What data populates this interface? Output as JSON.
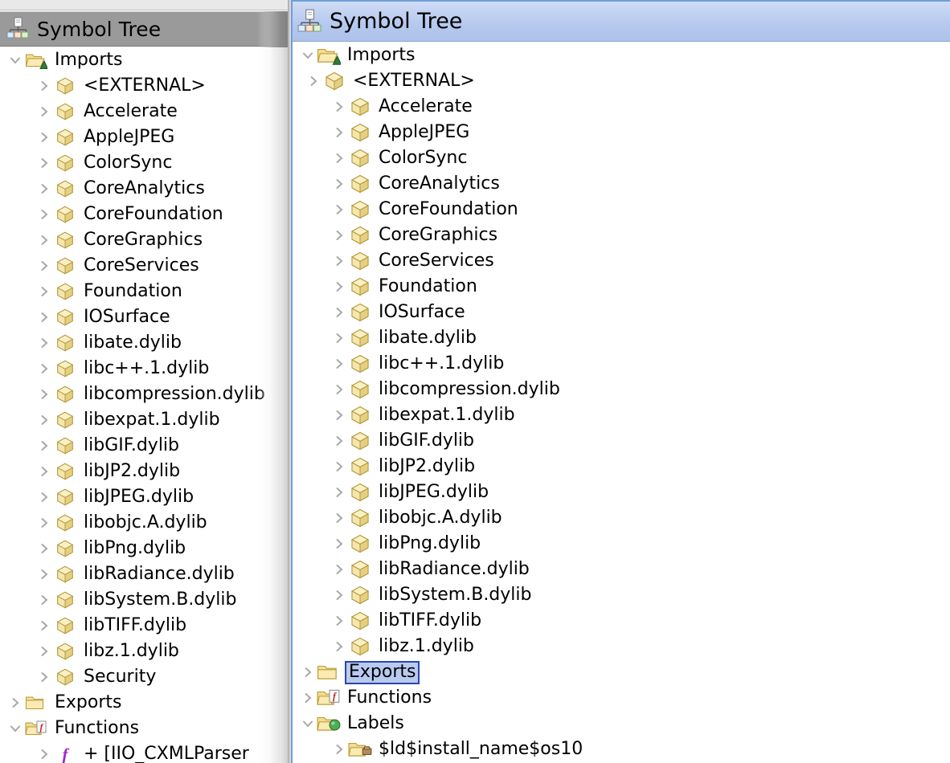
{
  "window": {
    "background_panel": {
      "title": "Symbol Tree",
      "icon": "symbol-tree-icon",
      "focused": false,
      "header_color": "#9a9a9a"
    },
    "foreground_panel": {
      "title": "Symbol Tree",
      "icon": "symbol-tree-icon",
      "focused": true,
      "header_color": "#b6c9ee",
      "border_color": "#6f9fd8"
    }
  },
  "selection": {
    "label": "Exports",
    "fill_color": "#b9caf1",
    "border_color": "#2a46a8"
  },
  "tree": {
    "root_items": [
      {
        "label": "Imports",
        "icon": "folder-open-imports-icon",
        "expanded": true,
        "level": 1
      },
      {
        "label": "Exports",
        "icon": "folder-closed-icon",
        "expanded": false,
        "level": 1
      },
      {
        "label": "Functions",
        "icon": "folder-functions-icon",
        "expanded": false,
        "level": 1
      },
      {
        "label": "Labels",
        "icon": "folder-labels-icon",
        "expanded": true,
        "level": 1
      }
    ],
    "imports_children": [
      {
        "label": "<EXTERNAL>",
        "icon": "library-cube-icon",
        "expanded": false,
        "extra_indent": true
      },
      {
        "label": "Accelerate",
        "icon": "library-cube-icon",
        "expanded": false
      },
      {
        "label": "AppleJPEG",
        "icon": "library-cube-icon",
        "expanded": false
      },
      {
        "label": "ColorSync",
        "icon": "library-cube-icon",
        "expanded": false
      },
      {
        "label": "CoreAnalytics",
        "icon": "library-cube-icon",
        "expanded": false
      },
      {
        "label": "CoreFoundation",
        "icon": "library-cube-icon",
        "expanded": false
      },
      {
        "label": "CoreGraphics",
        "icon": "library-cube-icon",
        "expanded": false
      },
      {
        "label": "CoreServices",
        "icon": "library-cube-icon",
        "expanded": false
      },
      {
        "label": "Foundation",
        "icon": "library-cube-icon",
        "expanded": false
      },
      {
        "label": "IOSurface",
        "icon": "library-cube-icon",
        "expanded": false
      },
      {
        "label": "libate.dylib",
        "icon": "library-cube-icon",
        "expanded": false
      },
      {
        "label": "libc++.1.dylib",
        "icon": "library-cube-icon",
        "expanded": false
      },
      {
        "label": "libcompression.dylib",
        "icon": "library-cube-icon",
        "expanded": false
      },
      {
        "label": "libexpat.1.dylib",
        "icon": "library-cube-icon",
        "expanded": false
      },
      {
        "label": "libGIF.dylib",
        "icon": "library-cube-icon",
        "expanded": false
      },
      {
        "label": "libJP2.dylib",
        "icon": "library-cube-icon",
        "expanded": false
      },
      {
        "label": "libJPEG.dylib",
        "icon": "library-cube-icon",
        "expanded": false
      },
      {
        "label": "libobjc.A.dylib",
        "icon": "library-cube-icon",
        "expanded": false
      },
      {
        "label": "libPng.dylib",
        "icon": "library-cube-icon",
        "expanded": false
      },
      {
        "label": "libRadiance.dylib",
        "icon": "library-cube-icon",
        "expanded": false
      },
      {
        "label": "libSystem.B.dylib",
        "icon": "library-cube-icon",
        "expanded": false
      },
      {
        "label": "libTIFF.dylib",
        "icon": "library-cube-icon",
        "expanded": false
      },
      {
        "label": "libz.1.dylib",
        "icon": "library-cube-icon",
        "expanded": false
      },
      {
        "label": "Security",
        "icon": "library-cube-icon",
        "expanded": false
      }
    ],
    "labels_children": [
      {
        "label": "$ld$install_name$os10",
        "icon": "folder-namespace-icon",
        "expanded": false
      }
    ],
    "functions_children": [
      {
        "label": "+ [IIO_CXMLParser",
        "icon": "function-icon",
        "expanded": false
      }
    ]
  },
  "left_panel_tree": {
    "visible_rows": [
      "Imports",
      "<EXTERNAL>",
      "Accelerate",
      "AppleJPEG",
      "ColorSync",
      "CoreAnalytics",
      "CoreFoundation",
      "CoreGraphics",
      "CoreServices",
      "Foundation",
      "IOSurface",
      "libate.dylib",
      "libc++.1.dylib",
      "libcompression.dyl",
      "libexpat.1.dylib",
      "libGIF.dylib",
      "libJP2.dylib",
      "libJPEG.dylib",
      "libobjc.A.dylib",
      "libPng.dylib",
      "libRadiance.dylib",
      "libSystem.B.dylib",
      "libTIFF.dylib",
      "libz.1.dylib",
      "Security",
      "Exports",
      "Functions",
      "+ [IIO_CXMLParser"
    ]
  },
  "right_panel_tree": {
    "visible_rows": [
      "Imports",
      "<EXTERNAL>",
      "Accelerate",
      "AppleJPEG",
      "ColorSync",
      "CoreAnalytics",
      "CoreFoundation",
      "CoreGraphics",
      "CoreServices",
      "Foundation",
      "IOSurface",
      "libate.dylib",
      "libc++.1.dylib",
      "libcompression.dylib",
      "libexpat.1.dylib",
      "libGIF.dylib",
      "libJP2.dylib",
      "libJPEG.dylib",
      "libobjc.A.dylib",
      "libPng.dylib",
      "libRadiance.dylib",
      "libSystem.B.dylib",
      "libTIFF.dylib",
      "libz.1.dylib",
      "Exports",
      "Functions",
      "Labels",
      "$ld$install_name$os10"
    ]
  }
}
